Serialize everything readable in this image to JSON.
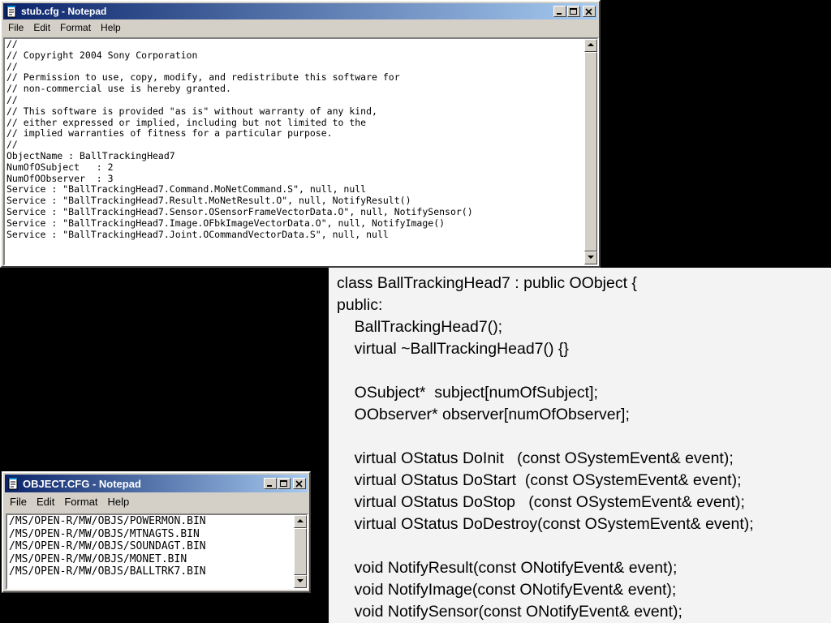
{
  "stub_window": {
    "title": "stub.cfg - Notepad",
    "menu": [
      "File",
      "Edit",
      "Format",
      "Help"
    ],
    "lines": [
      "//",
      "// Copyright 2004 Sony Corporation",
      "//",
      "// Permission to use, copy, modify, and redistribute this software for",
      "// non-commercial use is hereby granted.",
      "//",
      "// This software is provided \"as is\" without warranty of any kind,",
      "// either expressed or implied, including but not limited to the",
      "// implied warranties of fitness for a particular purpose.",
      "//",
      "",
      "ObjectName : BallTrackingHead7",
      "NumOfOSubject   : 2",
      "NumOfOObserver  : 3",
      "Service : \"BallTrackingHead7.Command.MoNetCommand.S\", null, null",
      "Service : \"BallTrackingHead7.Result.MoNetResult.O\", null, NotifyResult()",
      "Service : \"BallTrackingHead7.Sensor.OSensorFrameVectorData.O\", null, NotifySensor()",
      "Service : \"BallTrackingHead7.Image.OFbkImageVectorData.O\", null, NotifyImage()",
      "Service : \"BallTrackingHead7.Joint.OCommandVectorData.S\", null, null"
    ]
  },
  "object_window": {
    "title": "OBJECT.CFG - Notepad",
    "menu": [
      "File",
      "Edit",
      "Format",
      "Help"
    ],
    "lines": [
      "/MS/OPEN-R/MW/OBJS/POWERMON.BIN",
      "/MS/OPEN-R/MW/OBJS/MTNAGTS.BIN",
      "/MS/OPEN-R/MW/OBJS/SOUNDAGT.BIN",
      "/MS/OPEN-R/MW/OBJS/MONET.BIN",
      "/MS/OPEN-R/MW/OBJS/BALLTRK7.BIN"
    ]
  },
  "class_code": {
    "lines": [
      "class BallTrackingHead7 : public OObject {",
      "public:",
      "    BallTrackingHead7();",
      "    virtual ~BallTrackingHead7() {}",
      "",
      "    OSubject*  subject[numOfSubject];",
      "    OObserver* observer[numOfObserver];",
      "",
      "    virtual OStatus DoInit   (const OSystemEvent& event);",
      "    virtual OStatus DoStart  (const OSystemEvent& event);",
      "    virtual OStatus DoStop   (const OSystemEvent& event);",
      "    virtual OStatus DoDestroy(const OSystemEvent& event);",
      "",
      "    void NotifyResult(const ONotifyEvent& event);",
      "    void NotifyImage(const ONotifyEvent& event);",
      "    void NotifySensor(const ONotifyEvent& event);"
    ]
  },
  "icons": [
    "notepad-icon",
    "minimize-icon",
    "maximize-icon",
    "close-icon",
    "scroll-up-arrow-icon",
    "scroll-down-arrow-icon"
  ]
}
